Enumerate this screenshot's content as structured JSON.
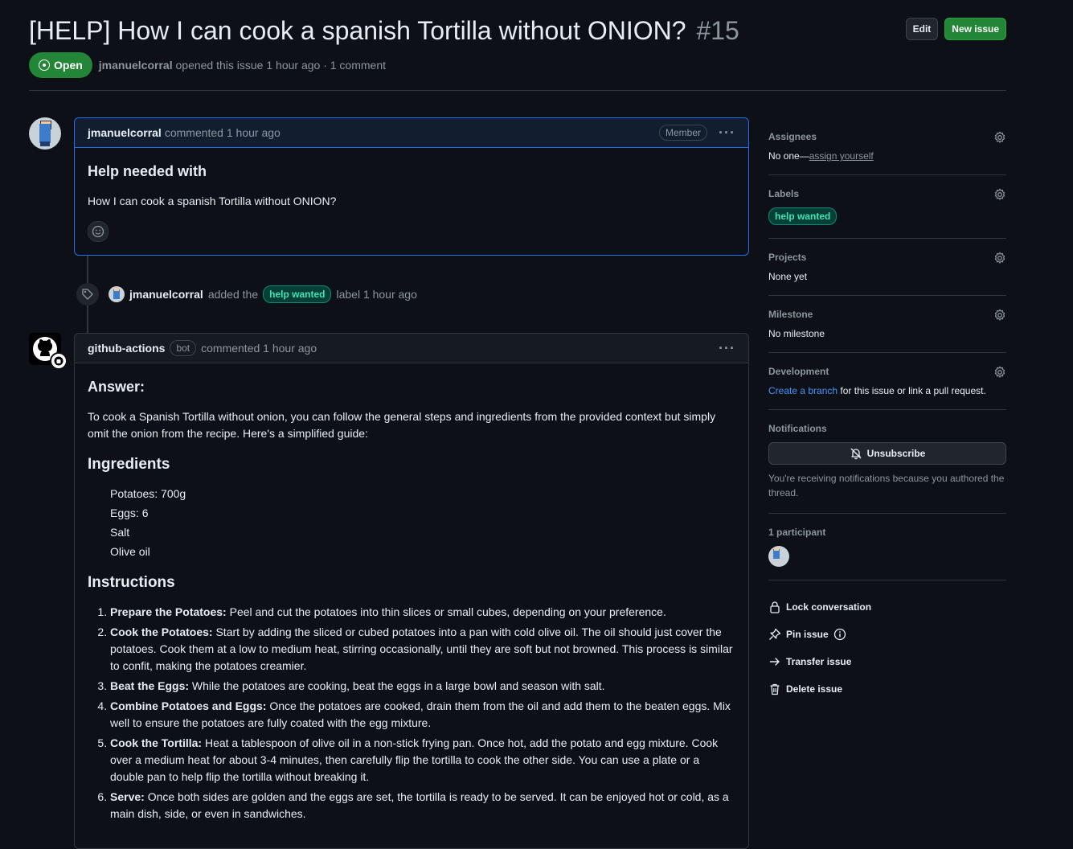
{
  "issue": {
    "title": "[HELP] How I can cook a spanish Tortilla without ONION?",
    "number": "#15",
    "state": "Open",
    "author": "jmanuelcorral",
    "opened_text": "opened this issue 1 hour ago · 1 comment"
  },
  "header_actions": {
    "edit": "Edit",
    "new_issue": "New issue"
  },
  "first_comment": {
    "author": "jmanuelcorral",
    "meta": "commented 1 hour ago",
    "role": "Member",
    "heading": "Help needed with",
    "body": "How I can cook a spanish Tortilla without ONION?"
  },
  "timeline_event": {
    "actor": "jmanuelcorral",
    "pre": "added the",
    "label": "help wanted",
    "post": "label 1 hour ago"
  },
  "bot_comment": {
    "author": "github-actions",
    "role": "bot",
    "meta": "commented 1 hour ago",
    "heading": "Answer:",
    "intro": "To cook a Spanish Tortilla without onion, you can follow the general steps and ingredients from the provided context but simply omit the onion from the recipe. Here's a simplified guide:",
    "ingredients_heading": "Ingredients",
    "ingredients": [
      "Potatoes: 700g",
      "Eggs: 6",
      "Salt",
      "Olive oil"
    ],
    "instructions_heading": "Instructions",
    "steps": [
      {
        "title": "Prepare the Potatoes:",
        "text": " Peel and cut the potatoes into thin slices or small cubes, depending on your preference."
      },
      {
        "title": "Cook the Potatoes:",
        "text": " Start by adding the sliced or cubed potatoes into a pan with cold olive oil. The oil should just cover the potatoes. Cook them at a low to medium heat, stirring occasionally, until they are soft but not browned. This process is similar to confit, making the potatoes creamier."
      },
      {
        "title": "Beat the Eggs:",
        "text": " While the potatoes are cooking, beat the eggs in a large bowl and season with salt."
      },
      {
        "title": "Combine Potatoes and Eggs:",
        "text": " Once the potatoes are cooked, drain them from the oil and add them to the beaten eggs. Mix well to ensure the potatoes are fully coated with the egg mixture."
      },
      {
        "title": "Cook the Tortilla:",
        "text": " Heat a tablespoon of olive oil in a non-stick frying pan. Once hot, add the potato and egg mixture. Cook over a medium heat for about 3-4 minutes, then carefully flip the tortilla to cook the other side. You can use a plate or a double pan to help flip the tortilla without breaking it."
      },
      {
        "title": "Serve:",
        "text": " Once both sides are golden and the eggs are set, the tortilla is ready to be served. It can be enjoyed hot or cold, as a main dish, side, or even in sandwiches."
      }
    ]
  },
  "sidebar": {
    "assignees": {
      "title": "Assignees",
      "value": "No one—",
      "link": "assign yourself"
    },
    "labels": {
      "title": "Labels",
      "label": "help wanted"
    },
    "projects": {
      "title": "Projects",
      "value": "None yet"
    },
    "milestone": {
      "title": "Milestone",
      "value": "No milestone"
    },
    "development": {
      "title": "Development",
      "link": "Create a branch",
      "value": " for this issue or link a pull request."
    },
    "notifications": {
      "title": "Notifications",
      "button": "Unsubscribe",
      "note": "You're receiving notifications because you authored the thread."
    },
    "participants": {
      "title": "1 participant"
    },
    "actions": {
      "lock": "Lock conversation",
      "pin": "Pin issue",
      "transfer": "Transfer issue",
      "delete": "Delete issue"
    }
  },
  "colors": {
    "background": "#0d1117",
    "open_state": "#238636",
    "link": "#4493f8",
    "label_text": "#3ee4b3"
  },
  "icons": [
    "issue-opened-icon",
    "tag-icon",
    "kebab-icon",
    "smiley-icon",
    "gear-icon",
    "bell-slash-icon",
    "lock-icon",
    "pin-icon",
    "info-icon",
    "arrow-right-icon",
    "trash-icon",
    "github-logo-icon"
  ]
}
